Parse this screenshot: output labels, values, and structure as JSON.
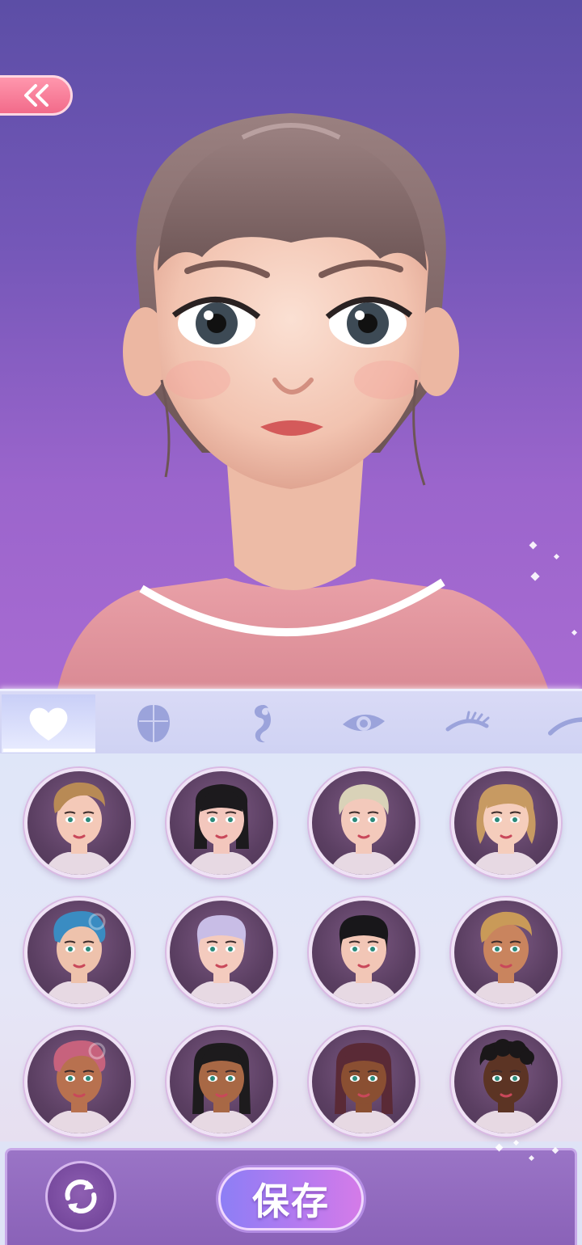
{
  "back_button": {
    "icon": "double-chevron-left-icon"
  },
  "tabs": [
    {
      "id": "favorites",
      "icon": "heart-icon",
      "active": true
    },
    {
      "id": "face-shape",
      "icon": "face-shape-icon",
      "active": false
    },
    {
      "id": "hair",
      "icon": "hair-curl-icon",
      "active": false
    },
    {
      "id": "eyes",
      "icon": "eye-icon",
      "active": false
    },
    {
      "id": "eyelashes",
      "icon": "eyelash-icon",
      "active": false
    },
    {
      "id": "eyebrows",
      "icon": "eyebrow-icon",
      "active": false
    }
  ],
  "presets": [
    {
      "hair": "#b88a55",
      "skin": "#f4c9b8",
      "style": "short-swept"
    },
    {
      "hair": "#1c1a1d",
      "skin": "#f3c7bd",
      "style": "bob-bangs"
    },
    {
      "hair": "#d9d2b8",
      "skin": "#f3c9bb",
      "style": "pixie-light"
    },
    {
      "hair": "#c79a62",
      "skin": "#f5cdbc",
      "style": "wavy-shoulder"
    },
    {
      "hair": "#3a8cc2",
      "skin": "#eec2ac",
      "style": "swirl-up"
    },
    {
      "hair": "#c8bde6",
      "skin": "#f4cbbe",
      "style": "bangs-bun"
    },
    {
      "hair": "#18171a",
      "skin": "#f2c6b6",
      "style": "bangs-bun"
    },
    {
      "hair": "#c99a58",
      "skin": "#c9845e",
      "style": "short-swept"
    },
    {
      "hair": "#c7627d",
      "skin": "#b8714f",
      "style": "swirl-up"
    },
    {
      "hair": "#1d1b1d",
      "skin": "#a86845",
      "style": "long-braids"
    },
    {
      "hair": "#5a2a36",
      "skin": "#8a4f32",
      "style": "long-braids"
    },
    {
      "hair": "#1a1719",
      "skin": "#5c3424",
      "style": "curly-short"
    }
  ],
  "bottom": {
    "reset_icon": "refresh-icon",
    "save_label": "保存"
  },
  "colors": {
    "bg_top": "#5c4ea6",
    "bg_bottom": "#a86bd2",
    "accent_pink": "#f26b8a",
    "panel": "#dfe6f8",
    "save_gradient": "#b47af0"
  }
}
